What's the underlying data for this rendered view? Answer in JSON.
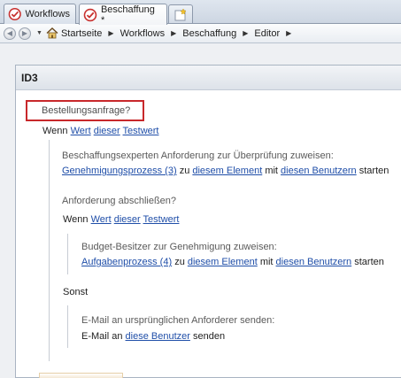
{
  "tabs": [
    {
      "label": "Workflows",
      "icon": "workflow-icon",
      "active": false
    },
    {
      "label": "Beschaffung *",
      "icon": "workflow-icon",
      "active": true
    }
  ],
  "new_tab_icon": "new-tab-icon",
  "breadcrumb": [
    "Startseite",
    "Workflows",
    "Beschaffung",
    "Editor"
  ],
  "panel": {
    "title": "ID3"
  },
  "steps": {
    "step_title": "Bestellungsanfrage?",
    "if1": {
      "wenn": "Wenn",
      "wert": "Wert",
      "dieser": "dieser",
      "testwert": "Testwert"
    },
    "action1": {
      "comment": "Beschaffungsexperten Anforderung zur Überprüfung zuweisen:",
      "process": "Genehmigungsprozess (3)",
      "zu": "zu",
      "element": "diesem Element",
      "mit": "mit",
      "users": "diesen Benutzern",
      "starten": "starten"
    },
    "comment2": "Anforderung abschließen?",
    "if2": {
      "wenn": "Wenn",
      "wert": "Wert",
      "dieser": "dieser",
      "testwert": "Testwert"
    },
    "action2": {
      "comment": "Budget-Besitzer zur Genehmigung zuweisen:",
      "process": "Aufgabenprozess (4)",
      "zu": "zu",
      "element": "diesem Element",
      "mit": "mit",
      "users": "diesen Benutzern",
      "starten": "starten"
    },
    "else_label": "Sonst",
    "action3": {
      "comment": "E-Mail an ursprünglichen Anforderer senden:",
      "prefix": "E-Mail an",
      "users": "diese Benutzer",
      "senden": "senden"
    }
  },
  "colors": {
    "link": "#1f4ea8",
    "highlight_border": "#c8282b"
  }
}
